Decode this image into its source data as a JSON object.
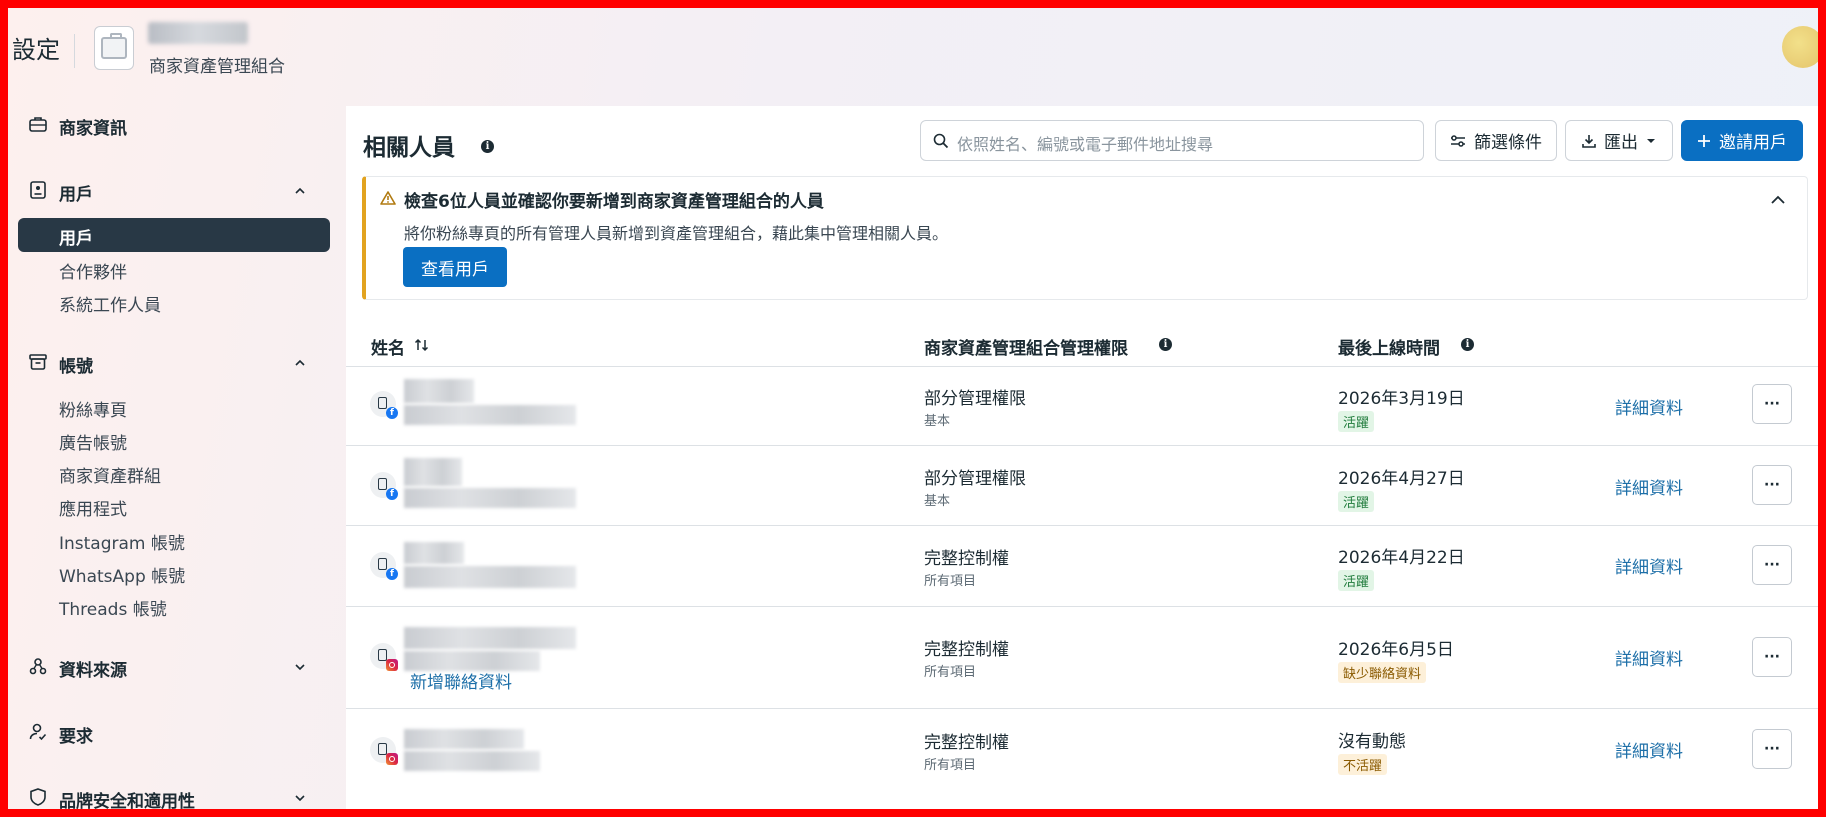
{
  "header": {
    "title": "設定",
    "portfolio_type": "商家資產管理組合"
  },
  "sidebar": {
    "business_info": "商家資訊",
    "users": {
      "label": "用戶",
      "items": [
        "用戶",
        "合作夥伴",
        "系統工作人員"
      ]
    },
    "accounts": {
      "label": "帳號",
      "items": [
        "粉絲專頁",
        "廣告帳號",
        "商家資產群組",
        "應用程式",
        "Instagram 帳號",
        "WhatsApp 帳號",
        "Threads 帳號"
      ]
    },
    "data_sources": "資料來源",
    "requests": "要求",
    "brand_safety": "品牌安全和適用性"
  },
  "main": {
    "title": "相關人員",
    "search_placeholder": "依照姓名、編號或電子郵件地址搜尋",
    "filter_label": "篩選條件",
    "export_label": "匯出",
    "invite_label": "邀請用戶",
    "alert": {
      "title": "檢查6位人員並確認你要新增到商家資產管理組合的人員",
      "desc": "將你粉絲專頁的所有管理人員新增到資產管理組合，藉此集中管理相關人員。",
      "cta": "查看用戶"
    },
    "table": {
      "col_name": "姓名",
      "col_permission": "商家資產管理組合管理權限",
      "col_last_active": "最後上線時間",
      "detail_label": "詳細資料",
      "more_label": "···",
      "rows": [
        {
          "permission": "部分管理權限",
          "scope": "基本",
          "last_active": "2026年3月19日",
          "status": "活躍"
        },
        {
          "permission": "部分管理權限",
          "scope": "基本",
          "last_active": "2026年4月27日",
          "status": "活躍"
        },
        {
          "permission": "完整控制權",
          "scope": "所有項目",
          "last_active": "2026年4月22日",
          "status": "活躍"
        },
        {
          "permission": "完整控制權",
          "scope": "所有項目",
          "last_active": "2026年6月5日",
          "status": "缺少聯絡資料",
          "add_contact": "新增聯絡資料"
        },
        {
          "permission": "完整控制權",
          "scope": "所有項目",
          "last_active": "沒有動態",
          "status": "不活躍"
        }
      ]
    }
  },
  "colors": {
    "primary": "#0a6fc2",
    "warning": "#e2a31f",
    "active_badge": "#1e7a3a",
    "frame": "#ff0000"
  }
}
